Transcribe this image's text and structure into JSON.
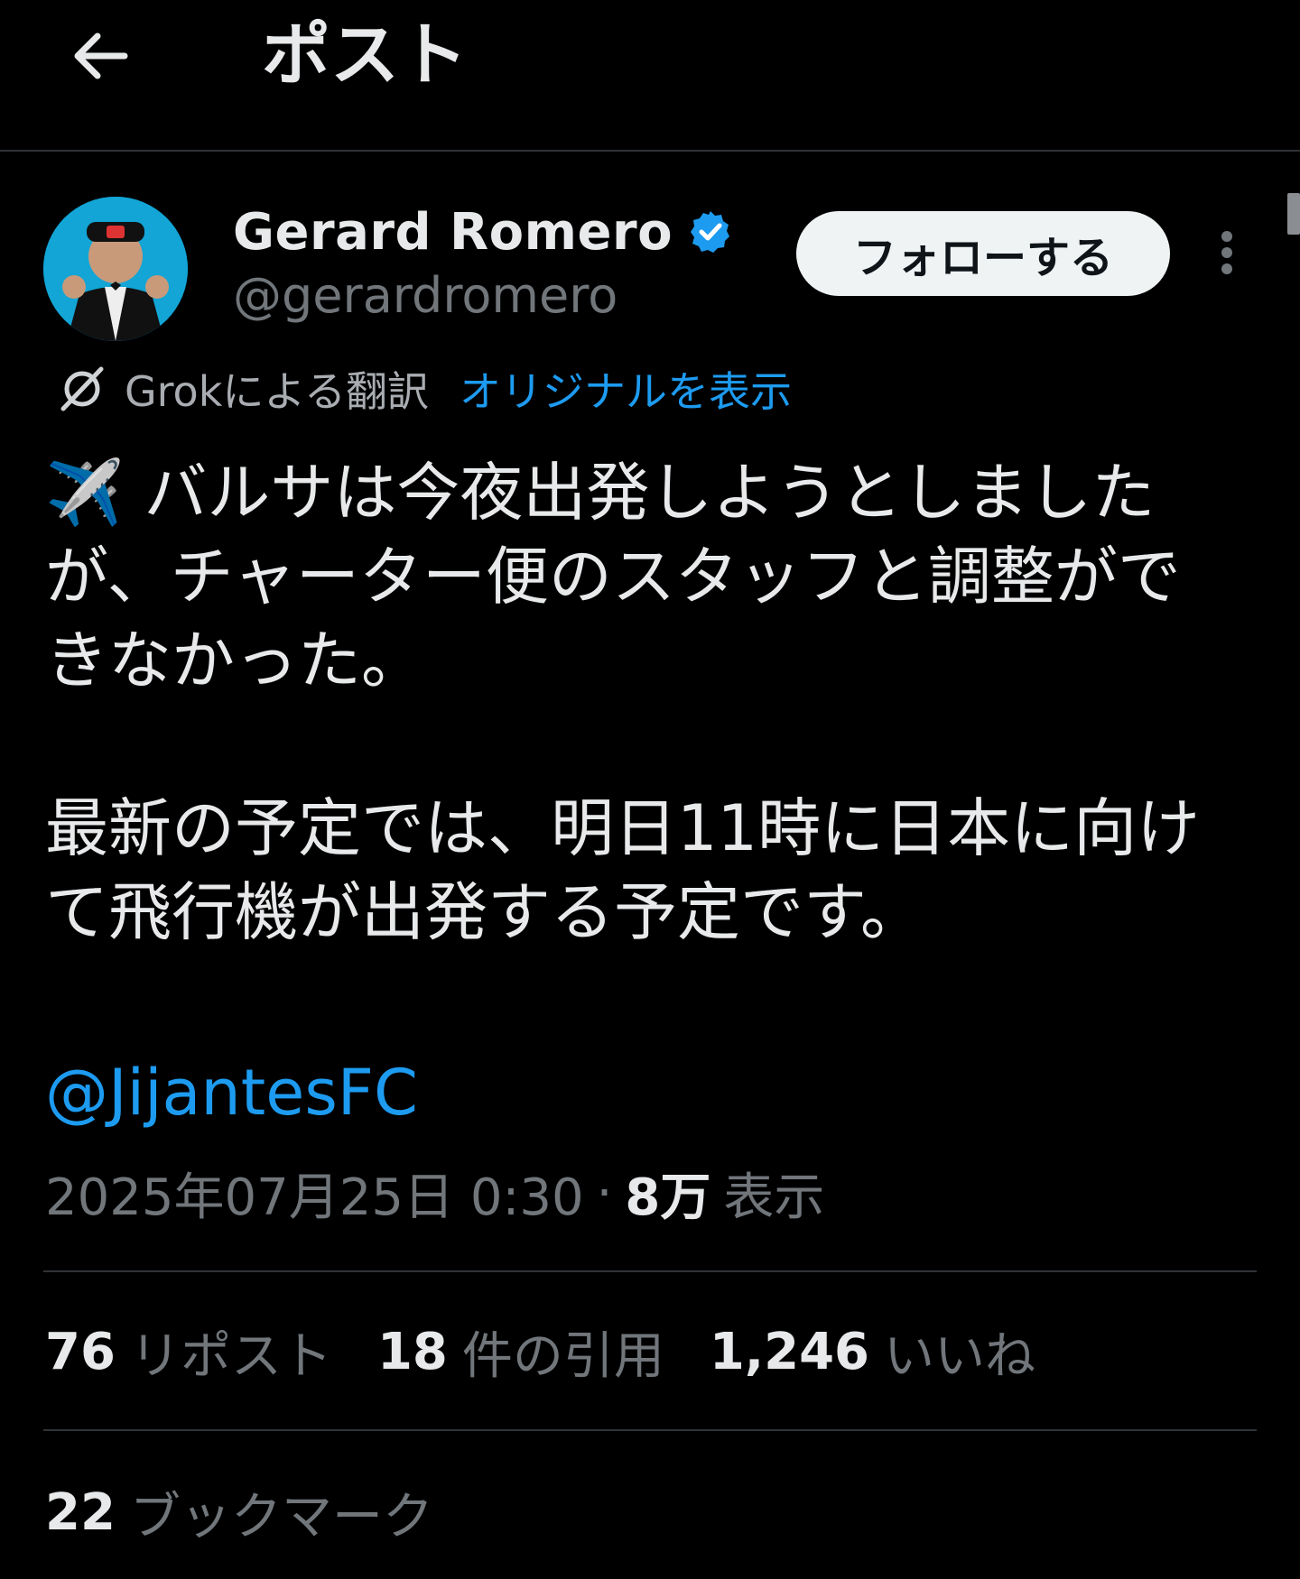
{
  "header": {
    "back_icon": "arrow-left-icon",
    "title": "ポスト"
  },
  "author": {
    "name": "Gerard Romero",
    "handle": "@gerardromero",
    "verified_icon": "verified-badge-icon",
    "verified_color": "#1d9bf0",
    "follow_label": "フォローする",
    "more_icon": "more-vertical-icon"
  },
  "translation": {
    "icon": "grok-icon",
    "label": "Grokによる翻訳",
    "show_original": "オリジナルを表示"
  },
  "post": {
    "emoji": "✈️",
    "lines": [
      "バルサは今夜出発しようとしました",
      "が、チャーター便のスタッフと調整がで",
      "きなかった。",
      "最新の予定では、明日11時に日本に向け",
      "て飛行機が出発する予定です。"
    ],
    "mention": "@JijantesFC"
  },
  "meta": {
    "datetime": "2025年07月25日 0:30",
    "separator": "·",
    "views_count": "8万",
    "views_label": "表示"
  },
  "stats": {
    "reposts": {
      "count": "76",
      "label": "リポスト"
    },
    "quotes": {
      "count": "18",
      "label": "件の引用"
    },
    "likes": {
      "count": "1,246",
      "label": "いいね"
    },
    "bookmarks": {
      "count": "22",
      "label": "ブックマーク"
    }
  },
  "colors": {
    "background": "#000000",
    "text": "#e7e9ea",
    "secondary_text": "#71767b",
    "accent": "#1d9bf0",
    "divider": "#2f3336",
    "follow_button_bg": "#eff3f4"
  }
}
